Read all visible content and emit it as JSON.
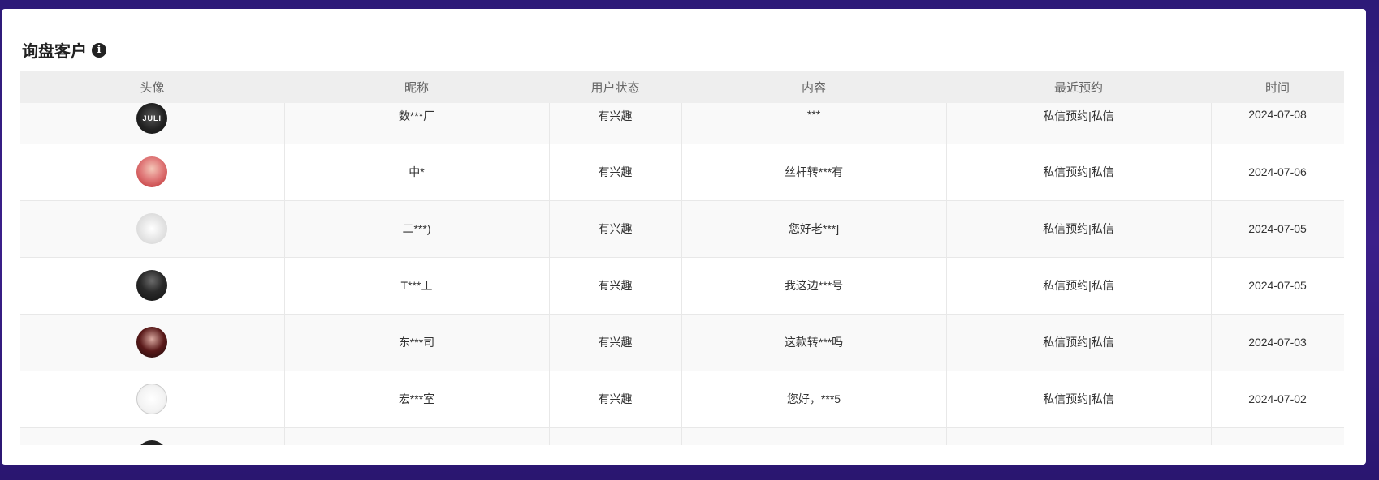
{
  "panel": {
    "title": "询盘客户",
    "info_icon": "info-circle-icon"
  },
  "table": {
    "columns": [
      "头像",
      "昵称",
      "用户状态",
      "内容",
      "最近预约",
      "时间"
    ],
    "rows": [
      {
        "avatar": "avatar-image",
        "nickname": "数***厂",
        "status": "有兴趣",
        "content": "***",
        "booking": "私信预约|私信",
        "time": "2024-07-08"
      },
      {
        "avatar": "avatar-image",
        "nickname": "中*",
        "status": "有兴趣",
        "content": "丝杆转***有",
        "booking": "私信预约|私信",
        "time": "2024-07-06"
      },
      {
        "avatar": "avatar-image",
        "nickname": "二***)",
        "status": "有兴趣",
        "content": "您好老***]",
        "booking": "私信预约|私信",
        "time": "2024-07-05"
      },
      {
        "avatar": "avatar-image",
        "nickname": "T***王",
        "status": "有兴趣",
        "content": "我这边***号",
        "booking": "私信预约|私信",
        "time": "2024-07-05"
      },
      {
        "avatar": "avatar-image",
        "nickname": "东***司",
        "status": "有兴趣",
        "content": "这款转***吗",
        "booking": "私信预约|私信",
        "time": "2024-07-03"
      },
      {
        "avatar": "avatar-image",
        "nickname": "宏***室",
        "status": "有兴趣",
        "content": "您好，***5",
        "booking": "私信预约|私信",
        "time": "2024-07-02"
      }
    ]
  },
  "colors": {
    "background": "#2d1a78",
    "header_bg": "#eeeeee",
    "row_alt_bg": "#f9f9f9"
  }
}
